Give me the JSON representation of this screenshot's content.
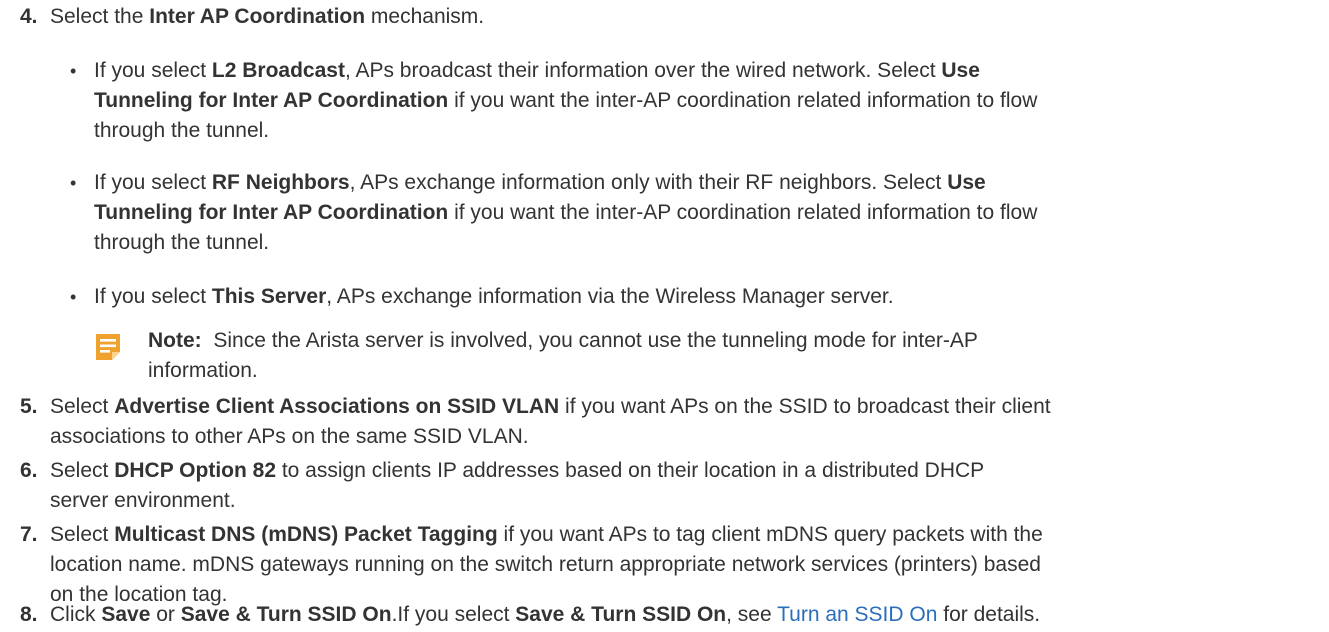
{
  "steps": [
    {
      "num": "4.",
      "a": "Select the ",
      "b1": "Inter AP Coordination",
      "c": " mechanism."
    },
    {
      "num": "5.",
      "a": "Select ",
      "b1": "Advertise Client Associations on SSID VLAN",
      "c": " if you want APs on the SSID to broadcast their client",
      "line2": "associations to other APs on the same SSID VLAN."
    },
    {
      "num": "6.",
      "a": "Select ",
      "b1": "DHCP Option 82",
      "c": " to assign clients IP addresses based on their location in a distributed DHCP",
      "line2": "server environment."
    },
    {
      "num": "7.",
      "a": "Select ",
      "b1": "Multicast DNS (mDNS) Packet Tagging",
      "c": " if you want APs to tag client mDNS query packets with the",
      "line2": "location name. mDNS gateways running on the switch return appropriate network services (printers) based",
      "line3": "on the location tag."
    },
    {
      "num": "8.",
      "a": "Click ",
      "b1": "Save",
      "c": " or ",
      "b2": "Save & Turn SSID On",
      "d": ".If you select ",
      "b3": "Save & Turn SSID On",
      "e": ", see ",
      "link": "Turn an SSID On",
      "f": " for details."
    }
  ],
  "bullets": [
    {
      "a": "If you select ",
      "b1": "L2 Broadcast",
      "c": ", APs broadcast their information over the wired network. Select ",
      "b2": "Use",
      "b3": "Tunneling for Inter AP Coordination",
      "d": " if you want the inter-AP coordination related information to flow",
      "line3": "through the tunnel."
    },
    {
      "a": "If you select ",
      "b1": "RF Neighbors",
      "c": ", APs exchange information only with their RF neighbors. Select ",
      "b2": "Use",
      "b3": "Tunneling for Inter AP Coordination",
      "d": " if you want the inter-AP coordination related information to flow",
      "line3": "through the tunnel."
    },
    {
      "a": "If you select ",
      "b1": "This Server",
      "c": ", APs exchange information via the Wireless Manager server."
    }
  ],
  "bullet_char": "•",
  "note": {
    "label": "Note:",
    "line1": "  Since the Arista server is involved, you cannot use the tunneling mode for inter-AP",
    "line2": "information.",
    "icon": "note-icon",
    "icon_color": "#f0a22e"
  },
  "colors": {
    "text": "#333333",
    "link": "#2a6ebb"
  }
}
